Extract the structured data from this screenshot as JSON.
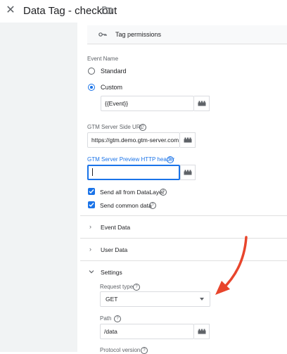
{
  "header": {
    "title": "Data Tag - checkout"
  },
  "tag_permissions": {
    "label": "Tag permissions"
  },
  "event_name": {
    "label": "Event Name",
    "options": [
      {
        "label": "Standard",
        "selected": false
      },
      {
        "label": "Custom",
        "selected": true
      }
    ],
    "custom_value": "{{Event}}"
  },
  "server_url": {
    "label": "GTM Server Side URL",
    "value": "https://gtm.demo.gtm-server.com"
  },
  "preview_header": {
    "label": "GTM Server Preview HTTP header",
    "value": ""
  },
  "checkboxes": [
    {
      "label": "Send all from DataLayer",
      "checked": true
    },
    {
      "label": "Send common data",
      "checked": true
    }
  ],
  "sections": {
    "event_data": "Event Data",
    "user_data": "User Data",
    "settings": "Settings"
  },
  "settings": {
    "request_type_label": "Request type",
    "request_type_value": "GET",
    "path_label": "Path",
    "path_value": "/data",
    "protocol_label": "Protocol version"
  },
  "colors": {
    "accent": "#1a73e8",
    "arrow": "#e8452c"
  }
}
